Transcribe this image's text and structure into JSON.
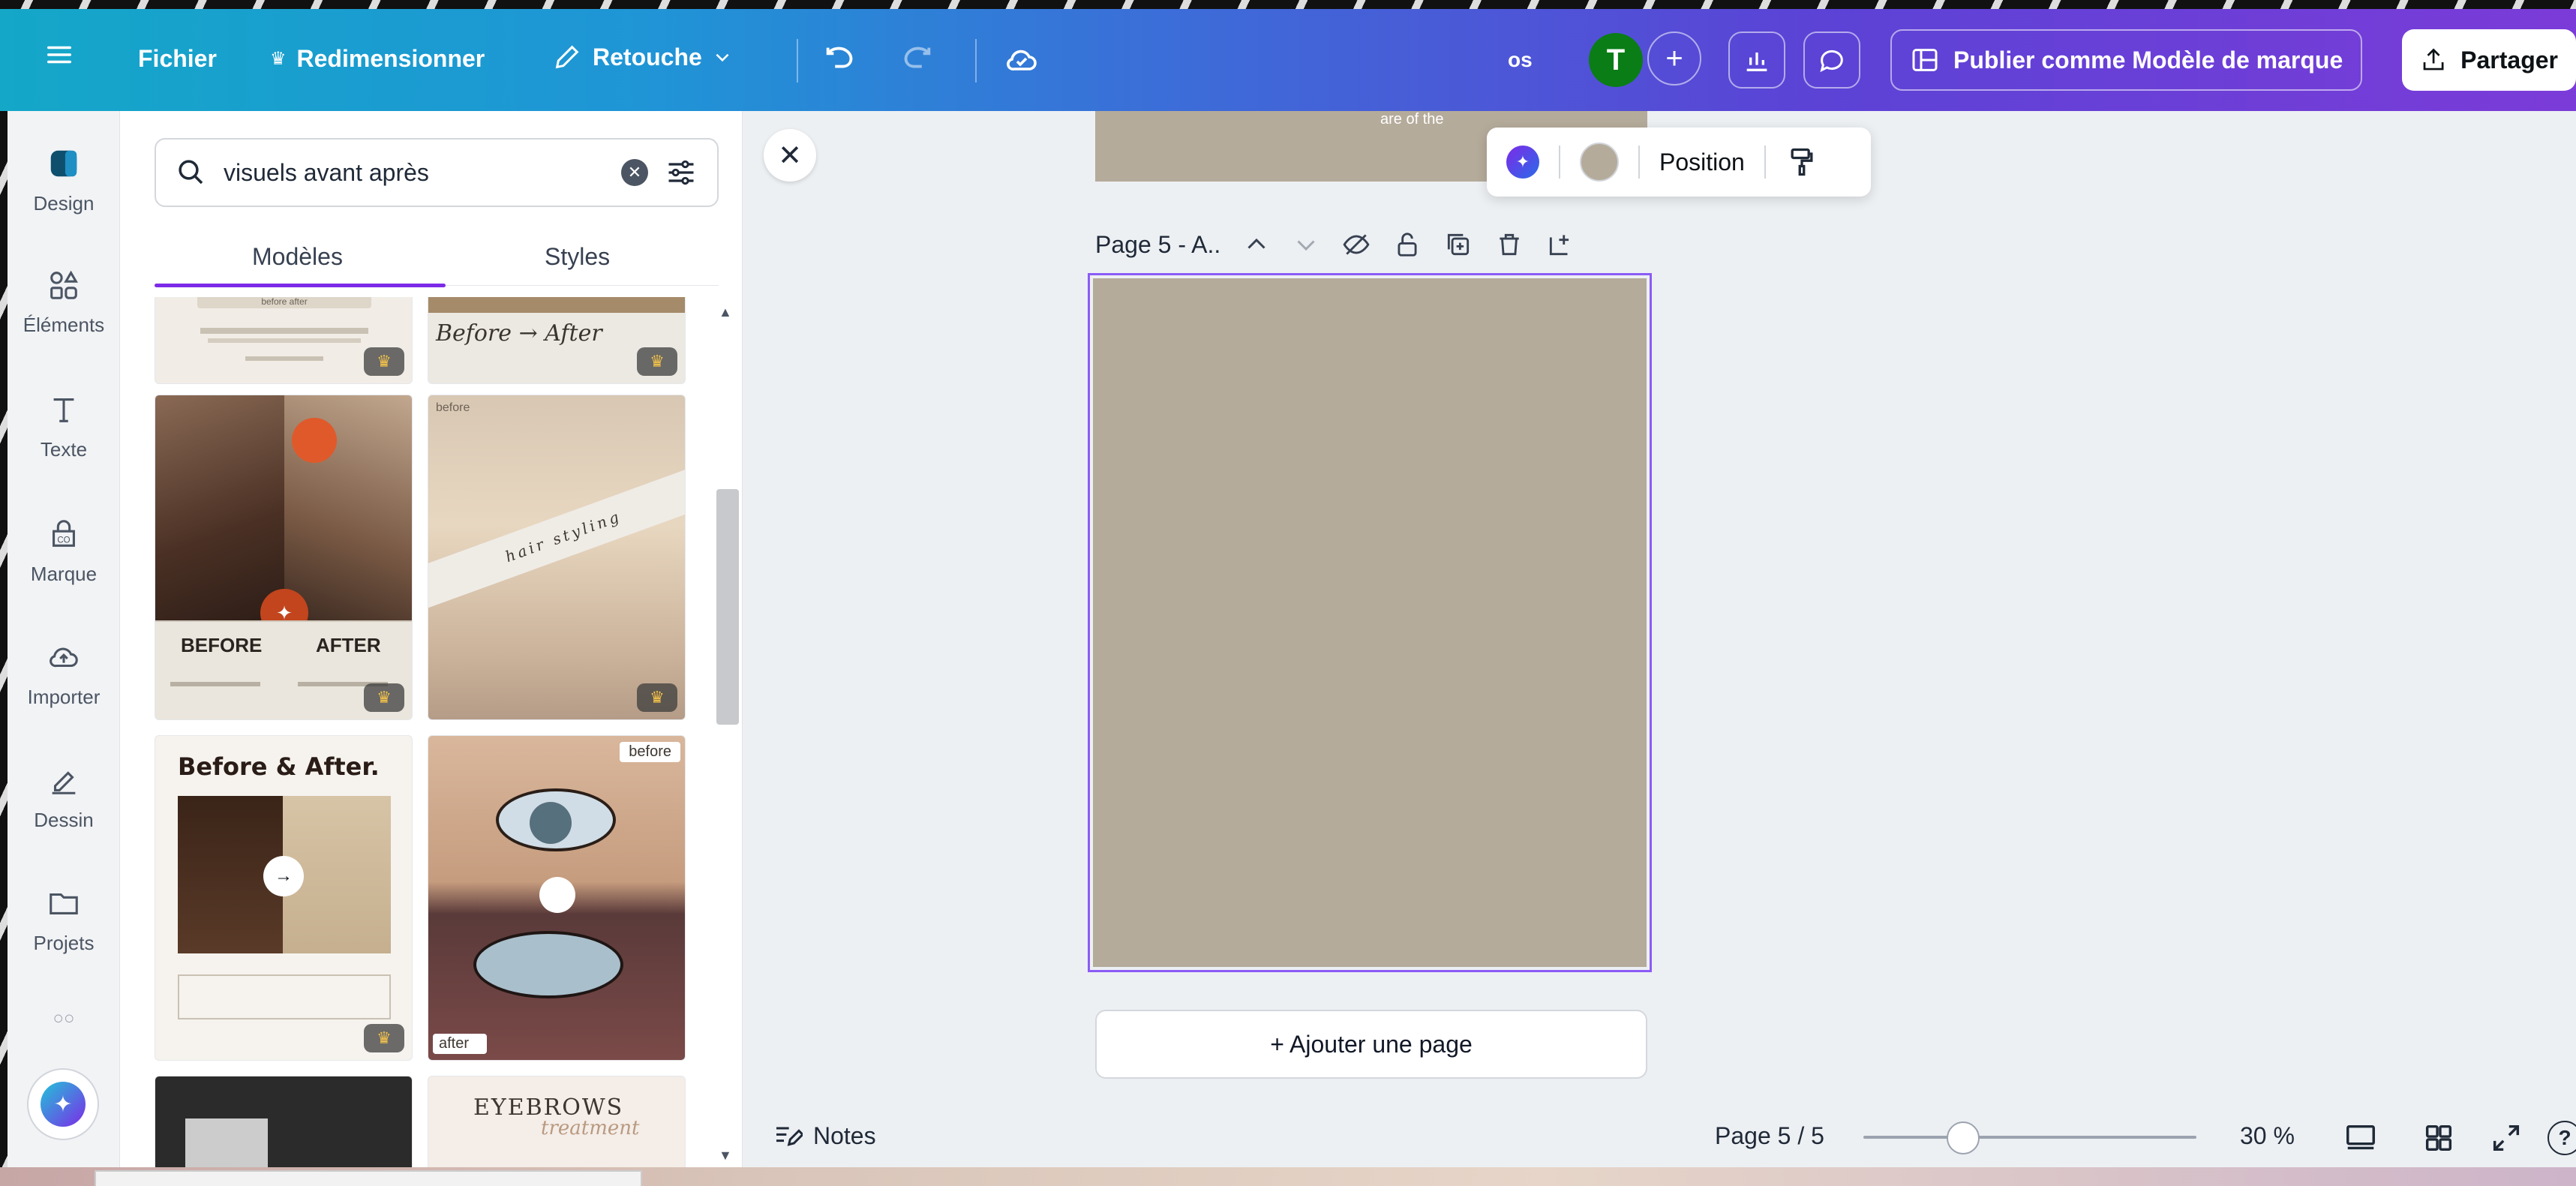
{
  "topbar": {
    "menu_icon": "hamburger-icon",
    "file_label": "Fichier",
    "resize_label": "Redimensionner",
    "retouch_label": "Retouche",
    "project_name": "os",
    "avatar_letter": "T",
    "brand_template_label": "Publier comme Modèle de marque",
    "share_label": "Partager"
  },
  "rail": {
    "items": [
      {
        "label": "Design",
        "icon": "design-icon"
      },
      {
        "label": "Éléments",
        "icon": "elements-icon"
      },
      {
        "label": "Texte",
        "icon": "text-icon"
      },
      {
        "label": "Marque",
        "icon": "brand-icon"
      },
      {
        "label": "Importer",
        "icon": "upload-icon"
      },
      {
        "label": "Dessin",
        "icon": "draw-icon"
      },
      {
        "label": "Projets",
        "icon": "folder-icon"
      }
    ]
  },
  "panel": {
    "search_value": "visuels avant après",
    "tabs": [
      {
        "label": "Modèles",
        "active": true
      },
      {
        "label": "Styles",
        "active": false
      }
    ],
    "cards": {
      "c1": {
        "text": "before after"
      },
      "c2": {
        "text": "Before → After"
      },
      "c3": {
        "label_left": "BEFORE",
        "label_right": "AFTER"
      },
      "c4": {
        "label": "before",
        "band": "hair styling"
      },
      "c5": {
        "title": "Before & After."
      },
      "c6": {
        "top_label": "before",
        "bottom_label": "after"
      },
      "c8": {
        "title": "EYEBROWS",
        "script": "treatment"
      }
    }
  },
  "canvas": {
    "prev_page_text": "are of the",
    "floating_position_label": "Position",
    "page_label": "Page 5 - A..",
    "add_page_label": "+ Ajouter une page",
    "notes_label": "Notes",
    "page_indicator": "Page 5 / 5",
    "zoom_label": "30 %",
    "zoom_level_fraction": 0.3,
    "page_color": "#b5ab9b"
  },
  "colors": {
    "accent": "#7d2ae8",
    "avatar": "#0a7d16"
  }
}
